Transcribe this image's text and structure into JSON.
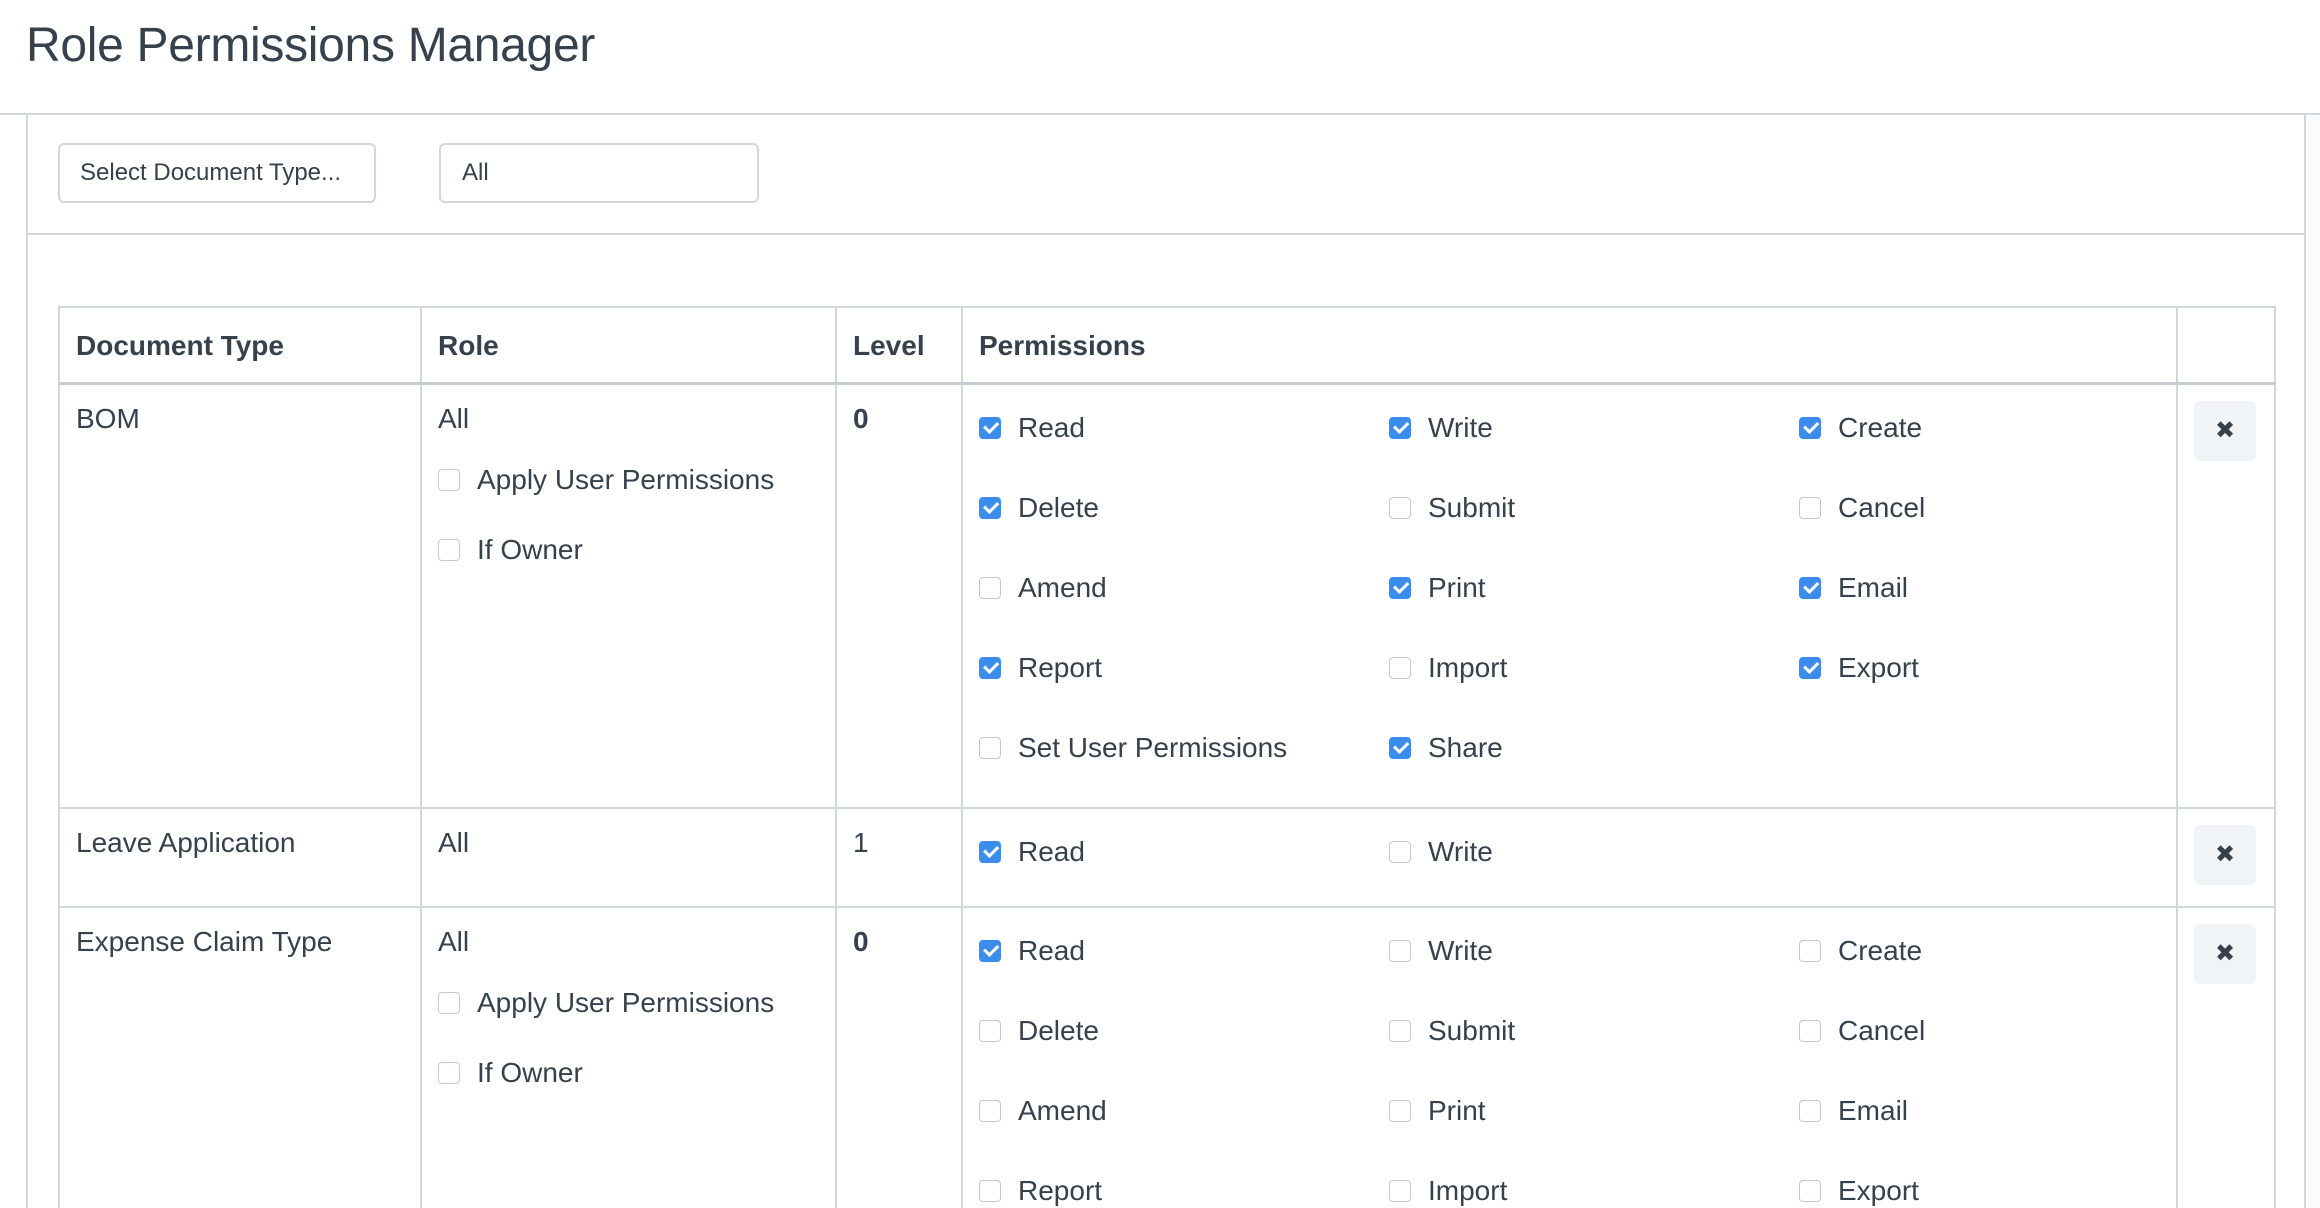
{
  "header": {
    "title": "Role Permissions Manager"
  },
  "filters": {
    "doctype_value": "Select Document Type...",
    "role_value": "All"
  },
  "table": {
    "columns": [
      "Document Type",
      "Role",
      "Level",
      "Permissions",
      ""
    ],
    "rows": [
      {
        "doctype": "BOM",
        "role": "All",
        "level": "0",
        "role_options": [
          {
            "label": "Apply User Permissions",
            "checked": false
          },
          {
            "label": "If Owner",
            "checked": false
          }
        ],
        "permissions": [
          {
            "label": "Read",
            "checked": true
          },
          {
            "label": "Write",
            "checked": true
          },
          {
            "label": "Create",
            "checked": true
          },
          {
            "label": "Delete",
            "checked": true
          },
          {
            "label": "Submit",
            "checked": false
          },
          {
            "label": "Cancel",
            "checked": false
          },
          {
            "label": "Amend",
            "checked": false
          },
          {
            "label": "Print",
            "checked": true
          },
          {
            "label": "Email",
            "checked": true
          },
          {
            "label": "Report",
            "checked": true
          },
          {
            "label": "Import",
            "checked": false
          },
          {
            "label": "Export",
            "checked": true
          },
          {
            "label": "Set User Permissions",
            "checked": false
          },
          {
            "label": "Share",
            "checked": true
          }
        ],
        "remove_icon": "close-icon"
      },
      {
        "doctype": "Leave Application",
        "role": "All",
        "level": "1",
        "role_options": [],
        "permissions": [
          {
            "label": "Read",
            "checked": true
          },
          {
            "label": "Write",
            "checked": false
          }
        ],
        "remove_icon": "close-icon"
      },
      {
        "doctype": "Expense Claim Type",
        "role": "All",
        "level": "0",
        "role_options": [
          {
            "label": "Apply User Permissions",
            "checked": false
          },
          {
            "label": "If Owner",
            "checked": false
          }
        ],
        "permissions": [
          {
            "label": "Read",
            "checked": true
          },
          {
            "label": "Write",
            "checked": false
          },
          {
            "label": "Create",
            "checked": false
          },
          {
            "label": "Delete",
            "checked": false
          },
          {
            "label": "Submit",
            "checked": false
          },
          {
            "label": "Cancel",
            "checked": false
          },
          {
            "label": "Amend",
            "checked": false
          },
          {
            "label": "Print",
            "checked": false
          },
          {
            "label": "Email",
            "checked": false
          },
          {
            "label": "Report",
            "checked": false
          },
          {
            "label": "Import",
            "checked": false
          },
          {
            "label": "Export",
            "checked": false
          }
        ],
        "remove_icon": "close-icon"
      }
    ]
  },
  "colors": {
    "accent": "#3b8cec",
    "text": "#36414c",
    "border": "#d1d8dd"
  }
}
